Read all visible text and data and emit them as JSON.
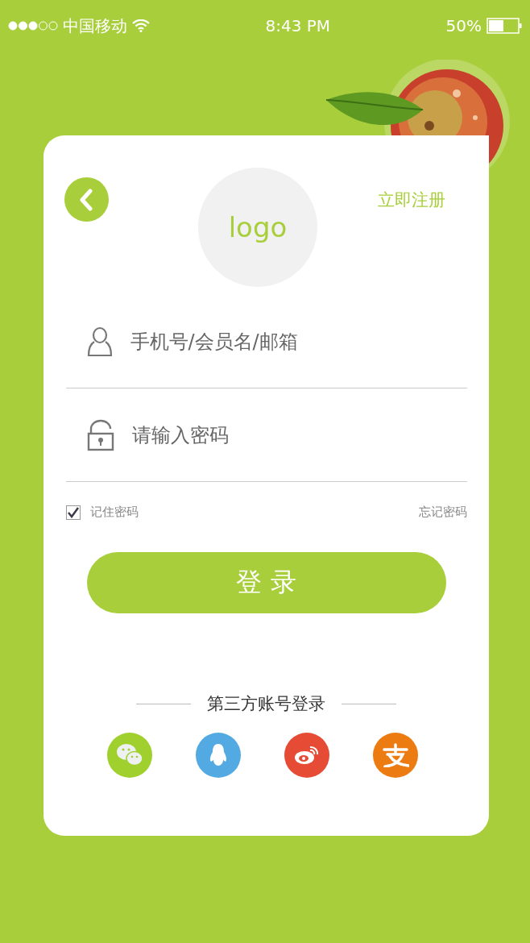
{
  "status_bar": {
    "carrier": "中国移动",
    "time": "8:43 PM",
    "battery": "50%"
  },
  "header": {
    "logo": "logo",
    "register": "立即注册"
  },
  "fields": [
    {
      "kind": "user",
      "placeholder": "手机号/会员名/邮箱"
    },
    {
      "kind": "lock",
      "placeholder": "请输入密码"
    }
  ],
  "remember": {
    "label": "记住密码",
    "checked": true
  },
  "forgot": "忘记密码",
  "login_button": "登 录",
  "third_party": {
    "title": "第三方账号登录",
    "providers": [
      {
        "kind": "chat",
        "color": "#9fd02e"
      },
      {
        "kind": "penguin",
        "color": "#53a9e2"
      },
      {
        "kind": "swirl",
        "color": "#e64b36"
      },
      {
        "kind": "glyph",
        "color": "#ec7c12"
      }
    ]
  }
}
